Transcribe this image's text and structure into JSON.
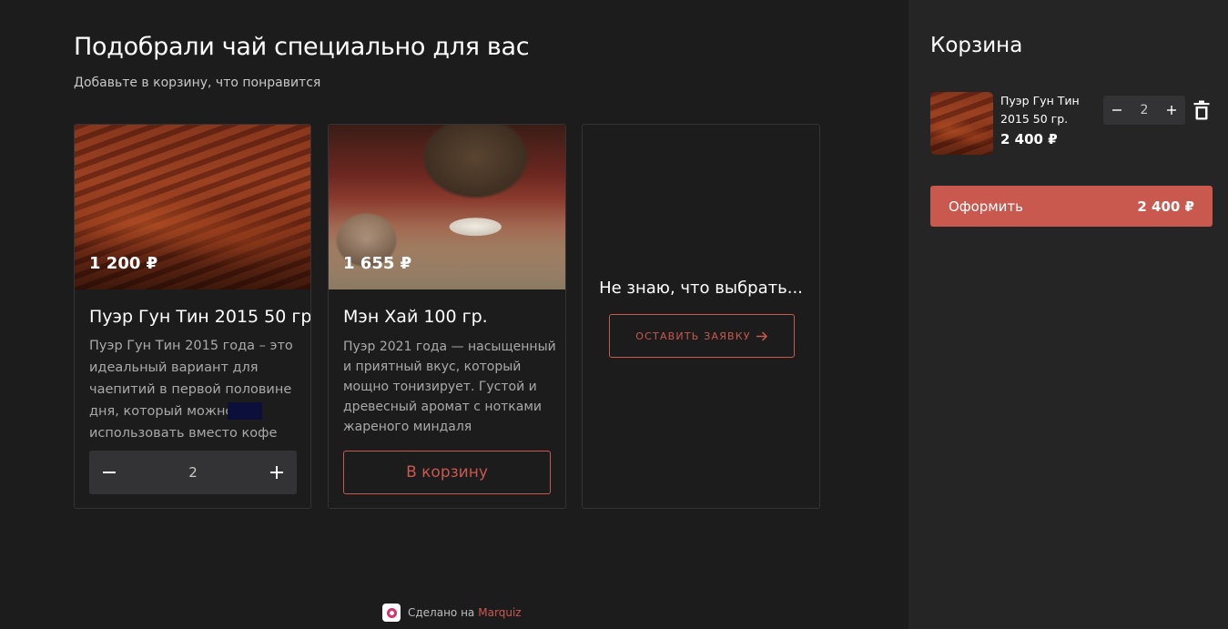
{
  "page": {
    "title": "Подобрали чай специально для вас",
    "subtitle": "Добавьте в корзину, что понравится"
  },
  "products": [
    {
      "price": "1 200 ₽",
      "name": "Пуэр Гун Тин 2015 50 гр.",
      "description": "Пуэр Гун Тин 2015 года – это идеальный вариант для чаепитий в первой половине дня, который можно использовать вместо кофе",
      "quantity": "2",
      "image": "tea-leaves-photo"
    },
    {
      "price": "1 655 ₽",
      "name": "Мэн Хай 100 гр.",
      "description": "Пуэр 2021 года — насыщенный и приятный вкус, который мощно тонизирует. Густой и древесный аромат с нотками жареного миндаля",
      "button_label": "В корзину",
      "image": "tea-cake-and-cup-photo"
    }
  ],
  "help_card": {
    "title": "Не знаю, что выбрать...",
    "button_label": "ОСТАВИТЬ ЗАЯВКУ",
    "button_icon": "arrow-right-icon"
  },
  "footer": {
    "made_on": "Сделано на",
    "brand": "Marquiz"
  },
  "cart": {
    "title": "Корзина",
    "items": [
      {
        "name": "Пуэр Гун Тин 2015 50 гр.",
        "price": "2 400 ₽",
        "quantity": "2"
      }
    ],
    "checkout_label": "Оформить",
    "total": "2 400 ₽"
  },
  "colors": {
    "background": "#1c1c1d",
    "sidebar": "#252526",
    "accent": "#c9584f",
    "stepper": "#333335"
  }
}
